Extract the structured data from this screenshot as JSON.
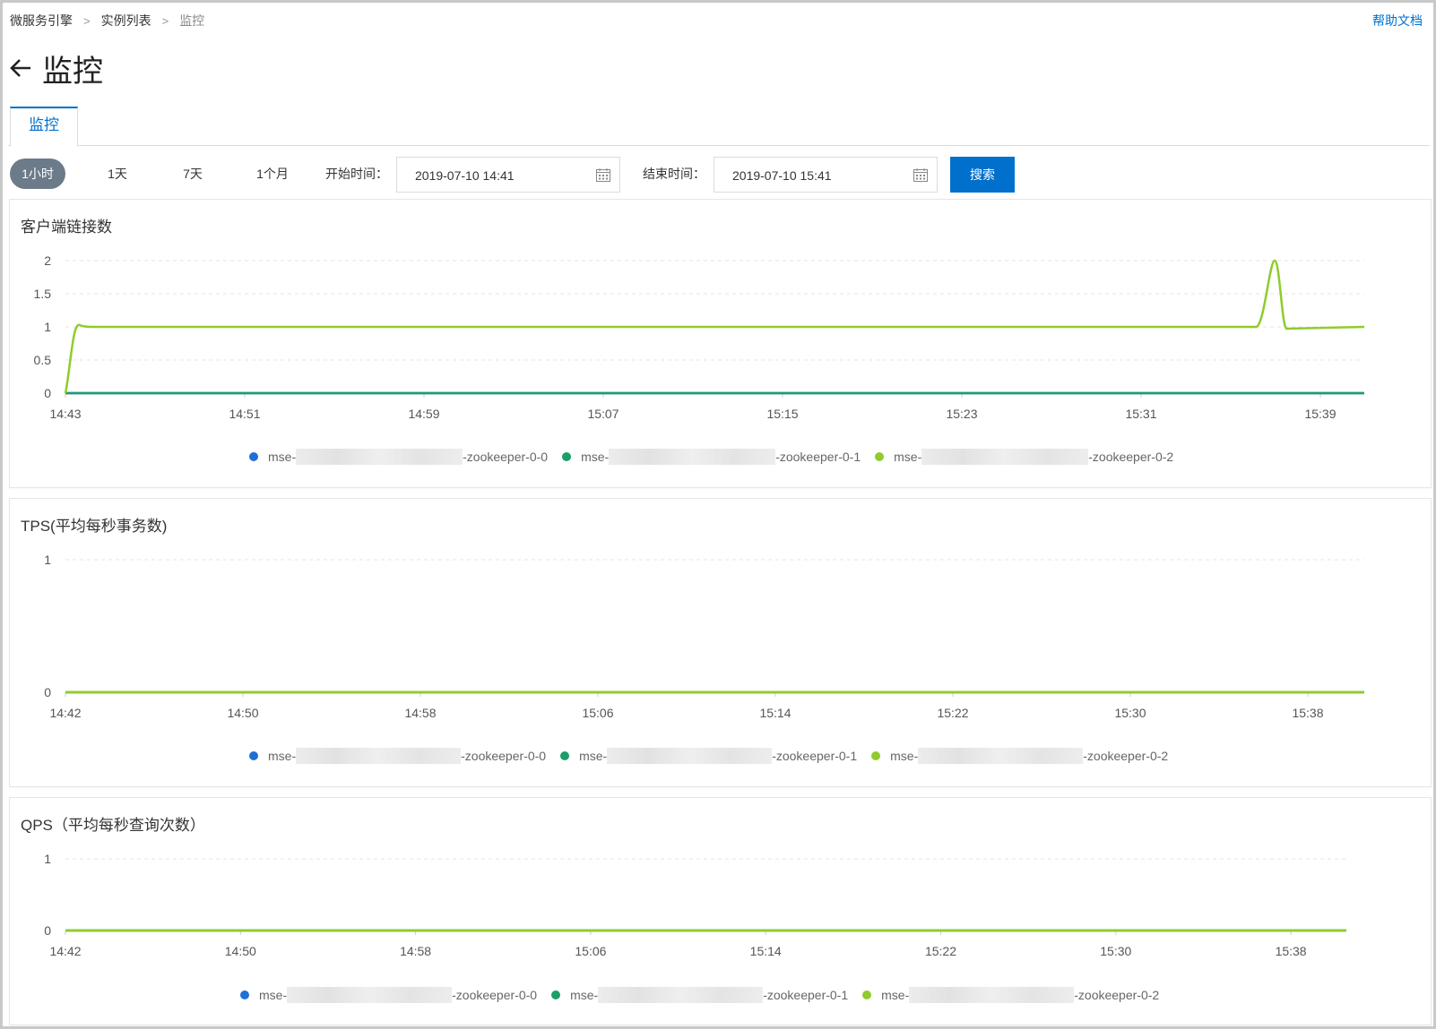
{
  "breadcrumb": {
    "items": [
      "微服务引擎",
      "实例列表",
      "监控"
    ],
    "separator": ">"
  },
  "help_link": "帮助文档",
  "page": {
    "title": "监控",
    "back_icon": "arrow-left-icon"
  },
  "tabs": [
    {
      "label": "监控",
      "active": true
    }
  ],
  "toolbar": {
    "ranges": [
      {
        "label": "1小时",
        "active": true
      },
      {
        "label": "1天",
        "active": false
      },
      {
        "label": "7天",
        "active": false
      },
      {
        "label": "1个月",
        "active": false
      }
    ],
    "start_label": "开始时间：",
    "start_value": "2019-07-10 14:41",
    "end_label": "结束时间：",
    "end_value": "2019-07-10 15:41",
    "search_label": "搜索",
    "calendar_icon": "calendar-icon"
  },
  "colors": {
    "accent": "#0070cc",
    "series": [
      "#1f6fd6",
      "#1a9e6a",
      "#8fcc2c"
    ]
  },
  "legend_series": [
    {
      "prefix": "mse-",
      "suffix": "-zookeeper-0-0"
    },
    {
      "prefix": "mse-",
      "suffix": "-zookeeper-0-1"
    },
    {
      "prefix": "mse-",
      "suffix": "-zookeeper-0-2"
    }
  ],
  "chart_data": [
    {
      "type": "line",
      "title": "客户端链接数",
      "x": [
        "14:43",
        "14:51",
        "14:59",
        "15:07",
        "15:15",
        "15:23",
        "15:31",
        "15:39"
      ],
      "yticks": [
        "0",
        "0.5",
        "1",
        "1.5",
        "2"
      ],
      "ylim": [
        0,
        2
      ],
      "grid": true,
      "legend": "bottom",
      "series": [
        {
          "name_prefix": "mse-",
          "name_suffix": "-zookeeper-0-0",
          "values": [
            0,
            0,
            0,
            0,
            0,
            0,
            0,
            0
          ]
        },
        {
          "name_prefix": "mse-",
          "name_suffix": "-zookeeper-0-1",
          "values": [
            0,
            0,
            0,
            0,
            0,
            0,
            0,
            0
          ]
        },
        {
          "name_prefix": "mse-",
          "name_suffix": "-zookeeper-0-2",
          "values": [
            0,
            1,
            1,
            1,
            1,
            1,
            1,
            1
          ],
          "spike": {
            "x": "15:36",
            "value": 2
          }
        }
      ]
    },
    {
      "type": "line",
      "title": "TPS(平均每秒事务数)",
      "x": [
        "14:42",
        "14:50",
        "14:58",
        "15:06",
        "15:14",
        "15:22",
        "15:30",
        "15:38"
      ],
      "yticks": [
        "0",
        "1"
      ],
      "ylim": [
        0,
        1
      ],
      "grid": true,
      "legend": "bottom",
      "series": [
        {
          "name_prefix": "mse-",
          "name_suffix": "-zookeeper-0-0",
          "values": [
            0,
            0,
            0,
            0,
            0,
            0,
            0,
            0
          ]
        },
        {
          "name_prefix": "mse-",
          "name_suffix": "-zookeeper-0-1",
          "values": [
            0,
            0,
            0,
            0,
            0,
            0,
            0,
            0
          ]
        },
        {
          "name_prefix": "mse-",
          "name_suffix": "-zookeeper-0-2",
          "values": [
            0,
            0,
            0,
            0,
            0,
            0,
            0,
            0
          ]
        }
      ]
    },
    {
      "type": "line",
      "title": "QPS（平均每秒查询次数）",
      "x": [
        "14:42",
        "14:50",
        "14:58",
        "15:06",
        "15:14",
        "15:22",
        "15:30",
        "15:38"
      ],
      "yticks": [
        "0",
        "1"
      ],
      "ylim": [
        0,
        1
      ],
      "grid": true,
      "legend": "bottom",
      "series": [
        {
          "name_prefix": "mse-",
          "name_suffix": "-zookeeper-0-0",
          "values": [
            0,
            0,
            0,
            0,
            0,
            0,
            0,
            0
          ]
        },
        {
          "name_prefix": "mse-",
          "name_suffix": "-zookeeper-0-1",
          "values": [
            0,
            0,
            0,
            0,
            0,
            0,
            0,
            0
          ]
        },
        {
          "name_prefix": "mse-",
          "name_suffix": "-zookeeper-0-2",
          "values": [
            0,
            0,
            0,
            0,
            0,
            0,
            0,
            0
          ]
        }
      ]
    }
  ]
}
